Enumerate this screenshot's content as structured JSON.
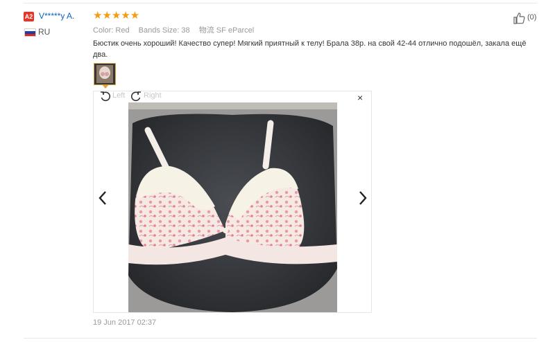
{
  "review": {
    "level_badge": "A2",
    "user_name": "V*****y A.",
    "country": "RU",
    "stars": "★★★★★",
    "color_label": "Color:",
    "color_value": "Red",
    "size_label": "Bands Size:",
    "size_value": "38",
    "shipping_label": "物流",
    "shipping_value": "SF eParcel",
    "text": "Бюстик очень хороший! Качество супер! Мягкий приятный к телу! Брала 38р. на свой 42-44 отлично подошёл, закала ещё два.",
    "helpful_count": "(0)",
    "date": "19 Jun 2017 02:37"
  },
  "viewer": {
    "rotate_left_label": "Left",
    "rotate_right_label": "Right",
    "close_label": "×"
  },
  "colors": {
    "link": "#0b62c4",
    "star": "#f39c12",
    "badge": "#e8332a",
    "thumb_border": "#d9a74a"
  },
  "icons": [
    "like-icon",
    "rotate-left-icon",
    "rotate-right-icon",
    "close-icon",
    "chevron-left-icon",
    "chevron-right-icon",
    "russia-flag-icon"
  ]
}
